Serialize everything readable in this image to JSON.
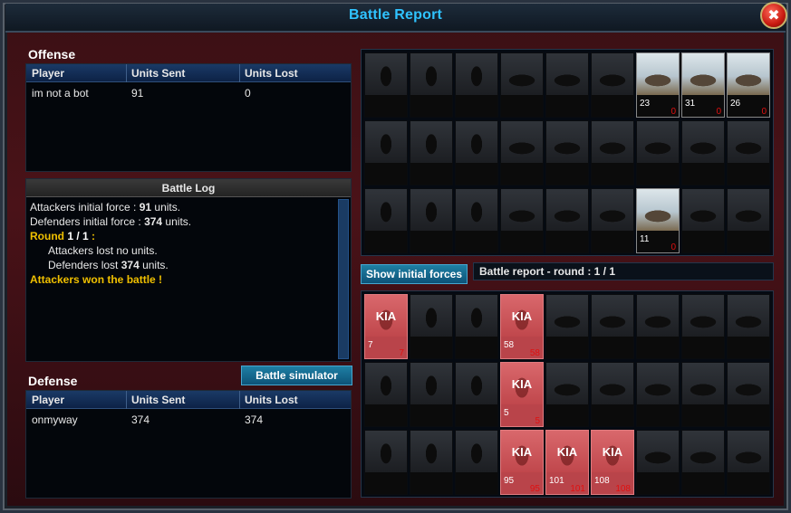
{
  "window": {
    "title": "Battle Report",
    "close_label": "✖"
  },
  "offense": {
    "title": "Offense",
    "headers": [
      "Player",
      "Units Sent",
      "Units Lost"
    ],
    "rows": [
      {
        "player": "im not a bot",
        "sent": "91",
        "lost": "0"
      }
    ]
  },
  "battle_log": {
    "title": "Battle Log",
    "lines": [
      {
        "prefix": "Attackers initial force : ",
        "bold": "91",
        "suffix": " units."
      },
      {
        "prefix": "Defenders initial force : ",
        "bold": "374",
        "suffix": " units."
      },
      {
        "round_text": "Round ",
        "round_value": "1 / 1",
        "round_suffix": " :"
      },
      {
        "indent_text": "Attackers lost no units."
      },
      {
        "prefix": "Defenders lost ",
        "bold": "374",
        "suffix": " units."
      },
      {
        "result": "Attackers won the battle !"
      }
    ],
    "scrollbar": "vertical"
  },
  "defense": {
    "title": "Defense",
    "simulator_label": "Battle simulator",
    "headers": [
      "Player",
      "Units Sent",
      "Units Lost"
    ],
    "rows": [
      {
        "player": "onmyway",
        "sent": "374",
        "lost": "374"
      }
    ]
  },
  "controls": {
    "show_initial_label": "Show initial forces",
    "round_label": "Battle report - round : 1 / 1"
  },
  "kia_text": "KIA",
  "attack_grid": {
    "cells": [
      {
        "row": 0,
        "col": 6,
        "count": "23",
        "lost": "0"
      },
      {
        "row": 0,
        "col": 7,
        "count": "31",
        "lost": "0"
      },
      {
        "row": 0,
        "col": 8,
        "count": "26",
        "lost": "0"
      },
      {
        "row": 2,
        "col": 6,
        "count": "11",
        "lost": "0"
      }
    ]
  },
  "defense_grid": {
    "cells": [
      {
        "row": 0,
        "col": 0,
        "count": "7",
        "lost": "7"
      },
      {
        "row": 0,
        "col": 3,
        "count": "58",
        "lost": "58"
      },
      {
        "row": 1,
        "col": 3,
        "count": "5",
        "lost": "5"
      },
      {
        "row": 2,
        "col": 3,
        "count": "95",
        "lost": "95"
      },
      {
        "row": 2,
        "col": 4,
        "count": "101",
        "lost": "101"
      },
      {
        "row": 2,
        "col": 5,
        "count": "108",
        "lost": "108"
      }
    ]
  },
  "colors": {
    "title": "#2fc3ff",
    "gold_text": "#f0c000",
    "loss_text": "#e01010",
    "kia_bg": "#c8555a"
  }
}
